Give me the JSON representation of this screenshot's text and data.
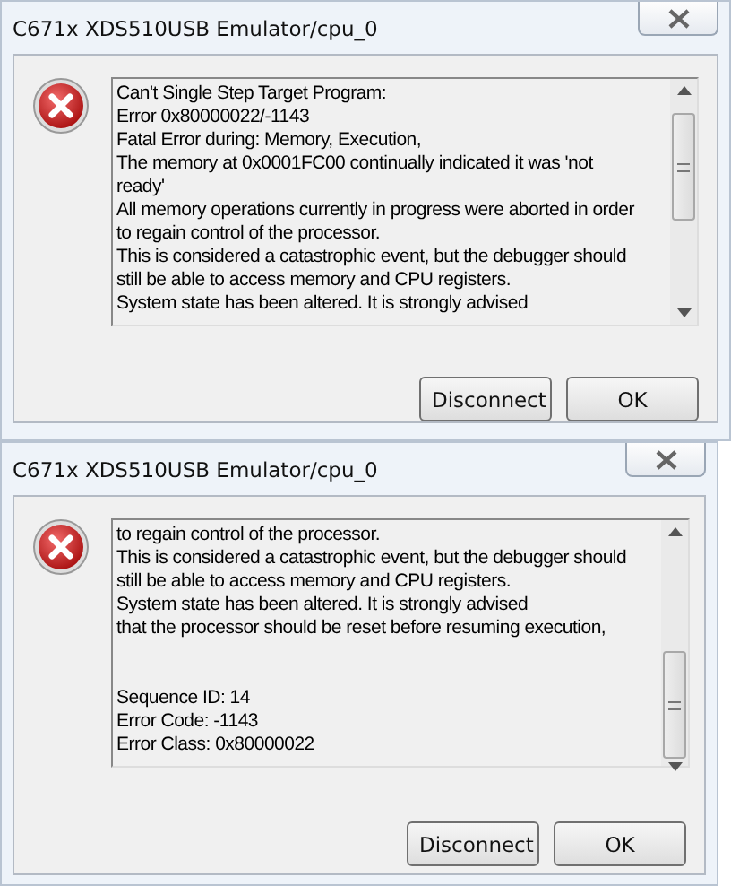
{
  "dialogs": [
    {
      "title": "C671x XDS510USB Emulator/cpu_0",
      "message_lines": [
        "Can't Single Step Target Program:",
        "Error 0x80000022/-1143",
        "Fatal Error during: Memory, Execution,",
        "The memory at 0x0001FC00 continually indicated it was 'not",
        "ready'",
        "All memory operations currently in progress were aborted in order",
        "to regain control of the processor.",
        "This is considered a catastrophic event, but the debugger should",
        "still be able to access memory and CPU registers.",
        "System state has been altered.  It is strongly advised"
      ],
      "buttons": [
        "Disconnect",
        "OK"
      ]
    },
    {
      "title": "C671x XDS510USB Emulator/cpu_0",
      "message_lines": [
        "to regain control of the processor.",
        "This is considered a catastrophic event, but the debugger should",
        "still be able to access memory and CPU registers.",
        "System state has been altered.  It is strongly advised",
        "that the processor should be reset before resuming execution,"
      ],
      "detail_lines": [
        "Sequence ID: 14",
        "Error Code: -1143",
        "Error Class: 0x80000022"
      ],
      "buttons": [
        "Disconnect",
        "OK"
      ]
    }
  ]
}
